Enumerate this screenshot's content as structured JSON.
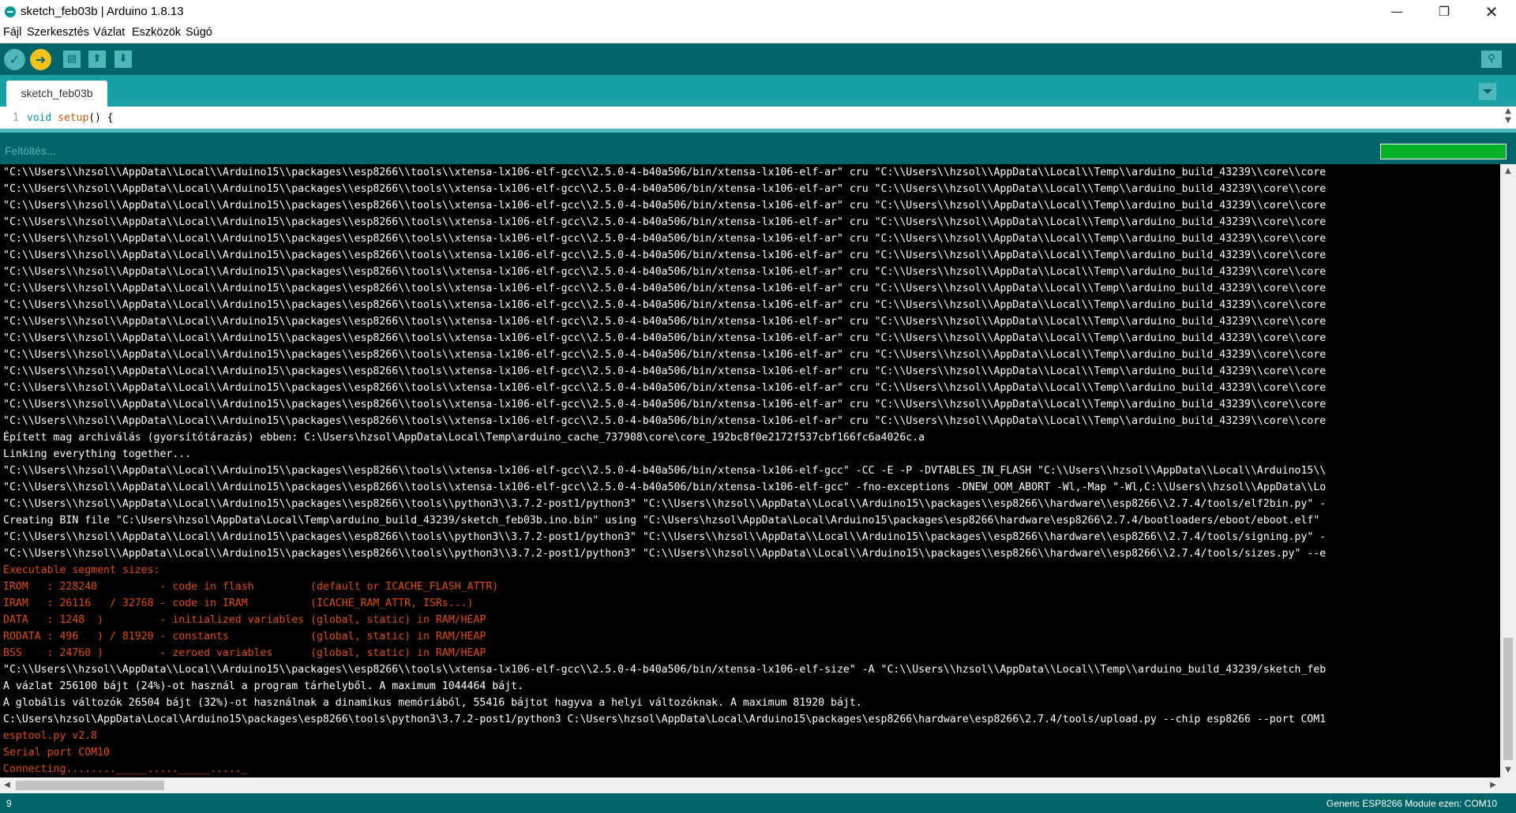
{
  "window": {
    "title": "sketch_feb03b | Arduino 1.8.13",
    "controls": {
      "minimize": "—",
      "maximize": "❐",
      "close": "✕"
    }
  },
  "menu": [
    "Fájl",
    "Szerkesztés",
    "Vázlat",
    "Eszközök",
    "Súgó"
  ],
  "toolbar": {
    "verify_icon": "check-icon",
    "upload_icon": "arrow-right-icon",
    "new_icon": "document-icon",
    "open_icon": "arrow-up-icon",
    "save_icon": "arrow-down-icon",
    "serial_icon": "magnifier-icon",
    "accent": "#006468",
    "upload_color": "#f3c21e"
  },
  "tabs": [
    "sketch_feb03b"
  ],
  "editor": {
    "line_number": "1",
    "code_keyword": "void",
    "code_function": "setup",
    "code_rest": "() {"
  },
  "status": {
    "text": "Feltöltés...",
    "progress_percent": 100,
    "progress_color": "#06b025"
  },
  "console": [
    {
      "text": "\"C:\\\\Users\\\\hzsol\\\\AppData\\\\Local\\\\Arduino15\\\\packages\\\\esp8266\\\\tools\\\\xtensa-lx106-elf-gcc\\\\2.5.0-4-b40a506/bin/xtensa-lx106-elf-ar\" cru \"C:\\\\Users\\\\hzsol\\\\AppData\\\\Local\\\\Temp\\\\arduino_build_43239\\\\core\\\\core",
      "color": "white"
    },
    {
      "text": "\"C:\\\\Users\\\\hzsol\\\\AppData\\\\Local\\\\Arduino15\\\\packages\\\\esp8266\\\\tools\\\\xtensa-lx106-elf-gcc\\\\2.5.0-4-b40a506/bin/xtensa-lx106-elf-ar\" cru \"C:\\\\Users\\\\hzsol\\\\AppData\\\\Local\\\\Temp\\\\arduino_build_43239\\\\core\\\\core",
      "color": "white"
    },
    {
      "text": "\"C:\\\\Users\\\\hzsol\\\\AppData\\\\Local\\\\Arduino15\\\\packages\\\\esp8266\\\\tools\\\\xtensa-lx106-elf-gcc\\\\2.5.0-4-b40a506/bin/xtensa-lx106-elf-ar\" cru \"C:\\\\Users\\\\hzsol\\\\AppData\\\\Local\\\\Temp\\\\arduino_build_43239\\\\core\\\\core",
      "color": "white"
    },
    {
      "text": "\"C:\\\\Users\\\\hzsol\\\\AppData\\\\Local\\\\Arduino15\\\\packages\\\\esp8266\\\\tools\\\\xtensa-lx106-elf-gcc\\\\2.5.0-4-b40a506/bin/xtensa-lx106-elf-ar\" cru \"C:\\\\Users\\\\hzsol\\\\AppData\\\\Local\\\\Temp\\\\arduino_build_43239\\\\core\\\\core",
      "color": "white"
    },
    {
      "text": "\"C:\\\\Users\\\\hzsol\\\\AppData\\\\Local\\\\Arduino15\\\\packages\\\\esp8266\\\\tools\\\\xtensa-lx106-elf-gcc\\\\2.5.0-4-b40a506/bin/xtensa-lx106-elf-ar\" cru \"C:\\\\Users\\\\hzsol\\\\AppData\\\\Local\\\\Temp\\\\arduino_build_43239\\\\core\\\\core",
      "color": "white"
    },
    {
      "text": "\"C:\\\\Users\\\\hzsol\\\\AppData\\\\Local\\\\Arduino15\\\\packages\\\\esp8266\\\\tools\\\\xtensa-lx106-elf-gcc\\\\2.5.0-4-b40a506/bin/xtensa-lx106-elf-ar\" cru \"C:\\\\Users\\\\hzsol\\\\AppData\\\\Local\\\\Temp\\\\arduino_build_43239\\\\core\\\\core",
      "color": "white"
    },
    {
      "text": "\"C:\\\\Users\\\\hzsol\\\\AppData\\\\Local\\\\Arduino15\\\\packages\\\\esp8266\\\\tools\\\\xtensa-lx106-elf-gcc\\\\2.5.0-4-b40a506/bin/xtensa-lx106-elf-ar\" cru \"C:\\\\Users\\\\hzsol\\\\AppData\\\\Local\\\\Temp\\\\arduino_build_43239\\\\core\\\\core",
      "color": "white"
    },
    {
      "text": "\"C:\\\\Users\\\\hzsol\\\\AppData\\\\Local\\\\Arduino15\\\\packages\\\\esp8266\\\\tools\\\\xtensa-lx106-elf-gcc\\\\2.5.0-4-b40a506/bin/xtensa-lx106-elf-ar\" cru \"C:\\\\Users\\\\hzsol\\\\AppData\\\\Local\\\\Temp\\\\arduino_build_43239\\\\core\\\\core",
      "color": "white"
    },
    {
      "text": "\"C:\\\\Users\\\\hzsol\\\\AppData\\\\Local\\\\Arduino15\\\\packages\\\\esp8266\\\\tools\\\\xtensa-lx106-elf-gcc\\\\2.5.0-4-b40a506/bin/xtensa-lx106-elf-ar\" cru \"C:\\\\Users\\\\hzsol\\\\AppData\\\\Local\\\\Temp\\\\arduino_build_43239\\\\core\\\\core",
      "color": "white"
    },
    {
      "text": "\"C:\\\\Users\\\\hzsol\\\\AppData\\\\Local\\\\Arduino15\\\\packages\\\\esp8266\\\\tools\\\\xtensa-lx106-elf-gcc\\\\2.5.0-4-b40a506/bin/xtensa-lx106-elf-ar\" cru \"C:\\\\Users\\\\hzsol\\\\AppData\\\\Local\\\\Temp\\\\arduino_build_43239\\\\core\\\\core",
      "color": "white"
    },
    {
      "text": "\"C:\\\\Users\\\\hzsol\\\\AppData\\\\Local\\\\Arduino15\\\\packages\\\\esp8266\\\\tools\\\\xtensa-lx106-elf-gcc\\\\2.5.0-4-b40a506/bin/xtensa-lx106-elf-ar\" cru \"C:\\\\Users\\\\hzsol\\\\AppData\\\\Local\\\\Temp\\\\arduino_build_43239\\\\core\\\\core",
      "color": "white"
    },
    {
      "text": "\"C:\\\\Users\\\\hzsol\\\\AppData\\\\Local\\\\Arduino15\\\\packages\\\\esp8266\\\\tools\\\\xtensa-lx106-elf-gcc\\\\2.5.0-4-b40a506/bin/xtensa-lx106-elf-ar\" cru \"C:\\\\Users\\\\hzsol\\\\AppData\\\\Local\\\\Temp\\\\arduino_build_43239\\\\core\\\\core",
      "color": "white"
    },
    {
      "text": "\"C:\\\\Users\\\\hzsol\\\\AppData\\\\Local\\\\Arduino15\\\\packages\\\\esp8266\\\\tools\\\\xtensa-lx106-elf-gcc\\\\2.5.0-4-b40a506/bin/xtensa-lx106-elf-ar\" cru \"C:\\\\Users\\\\hzsol\\\\AppData\\\\Local\\\\Temp\\\\arduino_build_43239\\\\core\\\\core",
      "color": "white"
    },
    {
      "text": "\"C:\\\\Users\\\\hzsol\\\\AppData\\\\Local\\\\Arduino15\\\\packages\\\\esp8266\\\\tools\\\\xtensa-lx106-elf-gcc\\\\2.5.0-4-b40a506/bin/xtensa-lx106-elf-ar\" cru \"C:\\\\Users\\\\hzsol\\\\AppData\\\\Local\\\\Temp\\\\arduino_build_43239\\\\core\\\\core",
      "color": "white"
    },
    {
      "text": "\"C:\\\\Users\\\\hzsol\\\\AppData\\\\Local\\\\Arduino15\\\\packages\\\\esp8266\\\\tools\\\\xtensa-lx106-elf-gcc\\\\2.5.0-4-b40a506/bin/xtensa-lx106-elf-ar\" cru \"C:\\\\Users\\\\hzsol\\\\AppData\\\\Local\\\\Temp\\\\arduino_build_43239\\\\core\\\\core",
      "color": "white"
    },
    {
      "text": "\"C:\\\\Users\\\\hzsol\\\\AppData\\\\Local\\\\Arduino15\\\\packages\\\\esp8266\\\\tools\\\\xtensa-lx106-elf-gcc\\\\2.5.0-4-b40a506/bin/xtensa-lx106-elf-ar\" cru \"C:\\\\Users\\\\hzsol\\\\AppData\\\\Local\\\\Temp\\\\arduino_build_43239\\\\core\\\\core",
      "color": "white"
    },
    {
      "text": "Épített mag archiválás (gyorsítótárazás) ebben: C:\\Users\\hzsol\\AppData\\Local\\Temp\\arduino_cache_737908\\core\\core_192bc8f0e2172f537cbf166fc6a4026c.a",
      "color": "white"
    },
    {
      "text": "Linking everything together...",
      "color": "white"
    },
    {
      "text": "\"C:\\\\Users\\\\hzsol\\\\AppData\\\\Local\\\\Arduino15\\\\packages\\\\esp8266\\\\tools\\\\xtensa-lx106-elf-gcc\\\\2.5.0-4-b40a506/bin/xtensa-lx106-elf-gcc\" -CC -E -P -DVTABLES_IN_FLASH \"C:\\\\Users\\\\hzsol\\\\AppData\\\\Local\\\\Arduino15\\\\",
      "color": "white"
    },
    {
      "text": "\"C:\\\\Users\\\\hzsol\\\\AppData\\\\Local\\\\Arduino15\\\\packages\\\\esp8266\\\\tools\\\\xtensa-lx106-elf-gcc\\\\2.5.0-4-b40a506/bin/xtensa-lx106-elf-gcc\" -fno-exceptions -DNEW_OOM_ABORT -Wl,-Map \"-Wl,C:\\\\Users\\\\hzsol\\\\AppData\\\\Lo",
      "color": "white"
    },
    {
      "text": "\"C:\\\\Users\\\\hzsol\\\\AppData\\\\Local\\\\Arduino15\\\\packages\\\\esp8266\\\\tools\\\\python3\\\\3.7.2-post1/python3\" \"C:\\\\Users\\\\hzsol\\\\AppData\\\\Local\\\\Arduino15\\\\packages\\\\esp8266\\\\hardware\\\\esp8266\\\\2.7.4/tools/elf2bin.py\" -",
      "color": "white"
    },
    {
      "text": "Creating BIN file \"C:\\Users\\hzsol\\AppData\\Local\\Temp\\arduino_build_43239/sketch_feb03b.ino.bin\" using \"C:\\Users\\hzsol\\AppData\\Local\\Arduino15\\packages\\esp8266\\hardware\\esp8266\\2.7.4/bootloaders/eboot/eboot.elf\"",
      "color": "white"
    },
    {
      "text": "\"C:\\\\Users\\\\hzsol\\\\AppData\\\\Local\\\\Arduino15\\\\packages\\\\esp8266\\\\tools\\\\python3\\\\3.7.2-post1/python3\" \"C:\\\\Users\\\\hzsol\\\\AppData\\\\Local\\\\Arduino15\\\\packages\\\\esp8266\\\\hardware\\\\esp8266\\\\2.7.4/tools/signing.py\" -",
      "color": "white"
    },
    {
      "text": "\"C:\\\\Users\\\\hzsol\\\\AppData\\\\Local\\\\Arduino15\\\\packages\\\\esp8266\\\\tools\\\\python3\\\\3.7.2-post1/python3\" \"C:\\\\Users\\\\hzsol\\\\AppData\\\\Local\\\\Arduino15\\\\packages\\\\esp8266\\\\hardware\\\\esp8266\\\\2.7.4/tools/sizes.py\" --e",
      "color": "white"
    },
    {
      "text": "Executable segment sizes:",
      "color": "red"
    },
    {
      "text": "IROM   : 228240          - code in flash         (default or ICACHE_FLASH_ATTR)",
      "color": "red"
    },
    {
      "text": "IRAM   : 26116   / 32768 - code in IRAM          (ICACHE_RAM_ATTR, ISRs...)",
      "color": "red"
    },
    {
      "text": "DATA   : 1248  )         - initialized variables (global, static) in RAM/HEAP",
      "color": "red"
    },
    {
      "text": "RODATA : 496   ) / 81920 - constants             (global, static) in RAM/HEAP",
      "color": "red"
    },
    {
      "text": "BSS    : 24760 )         - zeroed variables      (global, static) in RAM/HEAP",
      "color": "red"
    },
    {
      "text": "\"C:\\\\Users\\\\hzsol\\\\AppData\\\\Local\\\\Arduino15\\\\packages\\\\esp8266\\\\tools\\\\xtensa-lx106-elf-gcc\\\\2.5.0-4-b40a506/bin/xtensa-lx106-elf-size\" -A \"C:\\\\Users\\\\hzsol\\\\AppData\\\\Local\\\\Temp\\\\arduino_build_43239/sketch_feb",
      "color": "white"
    },
    {
      "text": "A vázlat 256100 bájt (24%)-ot használ a program tárhelyből. A maximum 1044464 bájt.",
      "color": "white"
    },
    {
      "text": "A globális változók 26504 bájt (32%)-ot használnak a dinamikus memóriából, 55416 bájtot hagyva a helyi változóknak. A maximum 81920 bájt.",
      "color": "white"
    },
    {
      "text": "C:\\Users\\hzsol\\AppData\\Local\\Arduino15\\packages\\esp8266\\tools\\python3\\3.7.2-post1/python3 C:\\Users\\hzsol\\AppData\\Local\\Arduino15\\packages\\esp8266\\hardware\\esp8266\\2.7.4/tools/upload.py --chip esp8266 --port COM1",
      "color": "white"
    },
    {
      "text": "esptool.py v2.8",
      "color": "red"
    },
    {
      "text": "Serial port COM10",
      "color": "red"
    },
    {
      "text": "Connecting........_____....._____....._",
      "color": "red"
    }
  ],
  "console_colors": {
    "white": "#ffffff",
    "red": "#e34c00"
  },
  "footer": {
    "line": "9",
    "board": "Generic ESP8266 Module ezen: COM10"
  }
}
